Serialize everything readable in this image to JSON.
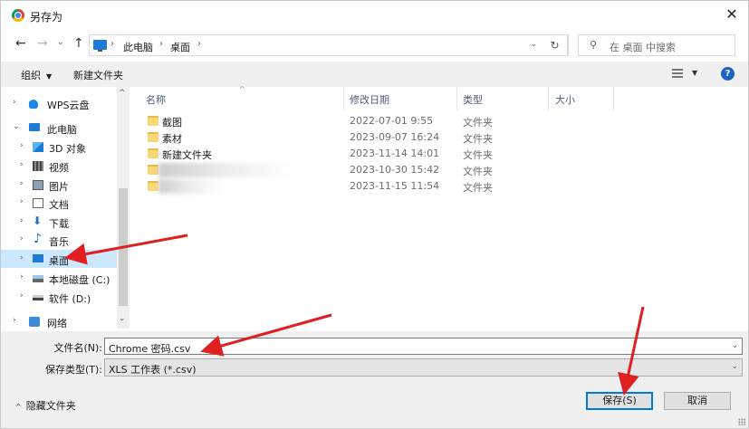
{
  "window": {
    "title": "另存为",
    "close_glyph": "✕"
  },
  "nav": {
    "back_glyph": "←",
    "forward_glyph": "→",
    "history_glyph": "⌄",
    "up_glyph": "↑"
  },
  "address": {
    "breadcrumb": [
      "此电脑",
      "桌面"
    ],
    "separator": "›",
    "dropdown_glyph": "⌄",
    "refresh_glyph": "↻"
  },
  "search": {
    "placeholder": "在 桌面 中搜索",
    "icon": "search-icon"
  },
  "toolbar": {
    "organize_label": "组织",
    "organize_arrow": "▼",
    "new_folder_label": "新建文件夹",
    "view_arrow": "▼",
    "help_label": "?"
  },
  "sidebar": {
    "items": [
      {
        "label": "WPS云盘",
        "icon": "cloud-icon",
        "expander": "›"
      },
      {
        "label": "此电脑",
        "icon": "computer-icon",
        "expander": "⌄"
      },
      {
        "label": "3D 对象",
        "icon": "cube-icon",
        "expander": "›"
      },
      {
        "label": "视频",
        "icon": "video-icon",
        "expander": "›"
      },
      {
        "label": "图片",
        "icon": "picture-icon",
        "expander": "›"
      },
      {
        "label": "文档",
        "icon": "document-icon",
        "expander": "›"
      },
      {
        "label": "下载",
        "icon": "download-icon",
        "expander": "›"
      },
      {
        "label": "音乐",
        "icon": "music-icon",
        "expander": "›"
      },
      {
        "label": "桌面",
        "icon": "desktop-icon",
        "expander": "›"
      },
      {
        "label": "本地磁盘 (C:)",
        "icon": "drive-icon",
        "expander": "›"
      },
      {
        "label": "软件 (D:)",
        "icon": "drive-icon",
        "expander": "›"
      },
      {
        "label": "网络",
        "icon": "network-icon",
        "expander": "›"
      }
    ],
    "selected_index": 8,
    "scroll_up_glyph": "^",
    "scroll_down_glyph": "⌄"
  },
  "files": {
    "columns": [
      "名称",
      "修改日期",
      "类型",
      "大小"
    ],
    "sort_glyph": "^",
    "rows": [
      {
        "name": "截图",
        "date": "2022-07-01 9:55",
        "type": "文件夹",
        "blurred": false
      },
      {
        "name": "素材",
        "date": "2023-09-07 16:24",
        "type": "文件夹",
        "blurred": false
      },
      {
        "name": "新建文件夹",
        "date": "2023-11-14 14:01",
        "type": "文件夹",
        "blurred": false
      },
      {
        "name": "",
        "date": "2023-10-30 15:42",
        "type": "文件夹",
        "blurred": true
      },
      {
        "name": "",
        "date": "2023-11-15 11:54",
        "type": "文件夹",
        "blurred": true
      }
    ]
  },
  "form": {
    "filename_label": "文件名(N):",
    "filename_value": "Chrome 密码.csv",
    "filetype_label": "保存类型(T):",
    "filetype_value": "XLS 工作表 (*.csv)",
    "dropdown_glyph": "⌄"
  },
  "footer": {
    "hide_folders_label": "隐藏文件夹",
    "hide_folders_arrow": "^",
    "save_label": "保存(S)",
    "cancel_label": "取消"
  },
  "colors": {
    "selection": "#cce8ff",
    "annotation_arrow": "#e02020",
    "accent": "#0078d7"
  }
}
